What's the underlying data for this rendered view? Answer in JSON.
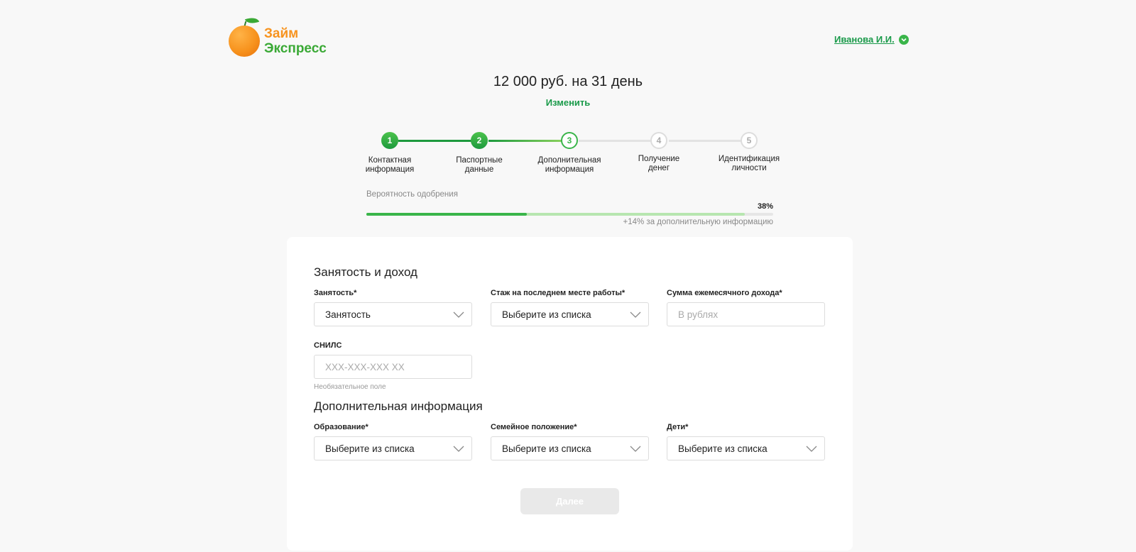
{
  "header": {
    "logo": {
      "line1": "Займ",
      "line2": "Экспресс"
    },
    "user_name": "Иванова И.И."
  },
  "loan": {
    "summary": "12 000 руб. на 31 день",
    "change_label": "Изменить"
  },
  "stepper": {
    "steps": [
      {
        "number": "1",
        "label_line1": "Контактная",
        "label_line2": "информация",
        "state": "done"
      },
      {
        "number": "2",
        "label_line1": "Паспортные",
        "label_line2": "данные",
        "state": "done"
      },
      {
        "number": "3",
        "label_line1": "Дополнительная",
        "label_line2": "информация",
        "state": "active"
      },
      {
        "number": "4",
        "label_line1": "Получение",
        "label_line2": "денег",
        "state": "pending"
      },
      {
        "number": "5",
        "label_line1": "Идентификация",
        "label_line2": "личности",
        "state": "pending"
      }
    ]
  },
  "approval": {
    "label": "Вероятность одобрения",
    "percent_text": "38%",
    "current_fraction": 0.395,
    "with_bonus_fraction": 0.93,
    "note": "+14% за дополнительную информацию"
  },
  "form": {
    "employment_section": {
      "title": "Занятость и доход",
      "employment": {
        "label": "Занятость*",
        "value": "Занятость"
      },
      "work_experience": {
        "label": "Стаж на последнем месте работы*",
        "value": "Выберите из списка"
      },
      "monthly_income": {
        "label": "Сумма ежемесячного дохода*",
        "placeholder": "В рублях"
      },
      "snils": {
        "label": "СНИЛС",
        "placeholder": "XXX-XXX-XXX XX",
        "hint": "Необязательное поле"
      }
    },
    "additional_section": {
      "title": "Дополнительная информация",
      "education": {
        "label": "Образование*",
        "value": "Выберите из списка"
      },
      "marital_status": {
        "label": "Семейное положение*",
        "value": "Выберите из списка"
      },
      "children": {
        "label": "Дети*",
        "value": "Выберите из списка"
      }
    },
    "next_label": "Далее"
  },
  "colors": {
    "brand_green": "#3ab54a",
    "brand_orange": "#f7931e",
    "link_green": "#1a9a4a"
  }
}
